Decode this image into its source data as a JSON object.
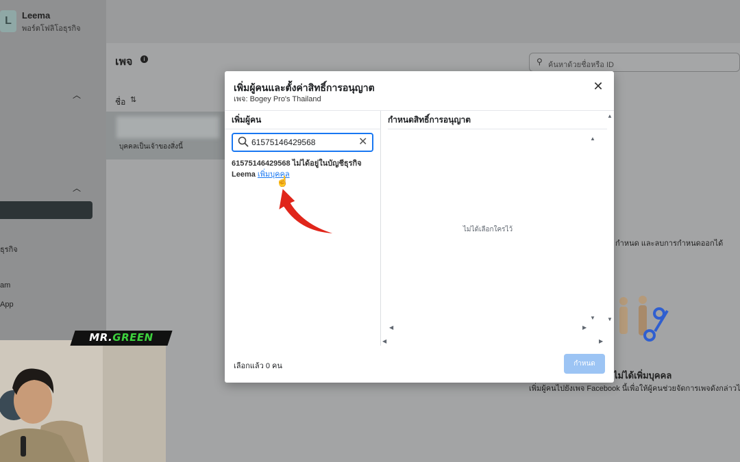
{
  "business": {
    "logo_letter": "L",
    "name": "Leema",
    "subtitle": "พอร์ตโฟลิโอธุรกิจ"
  },
  "sidebar": {
    "partial_items": [
      "ธุรกิจ",
      "am",
      "App"
    ]
  },
  "pages_panel": {
    "title": "เพจ",
    "name_column": "ชื่อ",
    "owner_text": "บุคคลเป็นเจ้าของสิ่งนี้",
    "search_placeholder": "ค้นหาด้วยชื่อหรือ ID",
    "right_hint": "กำหนด และลบการกำหนดออกได้",
    "empty_title": "ไม่ได้เพิ่มบุคคล",
    "empty_sub": "เพิ่มผู้คนไปยังเพจ Facebook นี้เพื่อให้ผู้คนช่วยจัดการเพจดังกล่าวไ"
  },
  "overlay_badge": {
    "part1": "MR.",
    "part2": "GREEN"
  },
  "modal": {
    "title": "เพิ่มผู้คนและตั้งค่าสิทธิ์การอนุญาต",
    "subtitle": "เพจ: Bogey Pro's Thailand",
    "left_header": "เพิ่มผู้คน",
    "right_header": "กำหนดสิทธิ์การอนุญาต",
    "search_value": "61575146429568",
    "result_message": "61575146429568 ไม่ได้อยู่ในบัญชีธุรกิจ Leema",
    "add_person_link": "เพิ่มบุคคล",
    "empty_selection": "ไม่ได้เลือกใครไว้",
    "selected_count": "เลือกแล้ว 0 คน",
    "assign_button": "กำหนด"
  },
  "colors": {
    "accent": "#1877f2",
    "disabled_button": "#9cc4f4",
    "arrow_red": "#e0261b",
    "badge_green": "#3dd13d"
  }
}
